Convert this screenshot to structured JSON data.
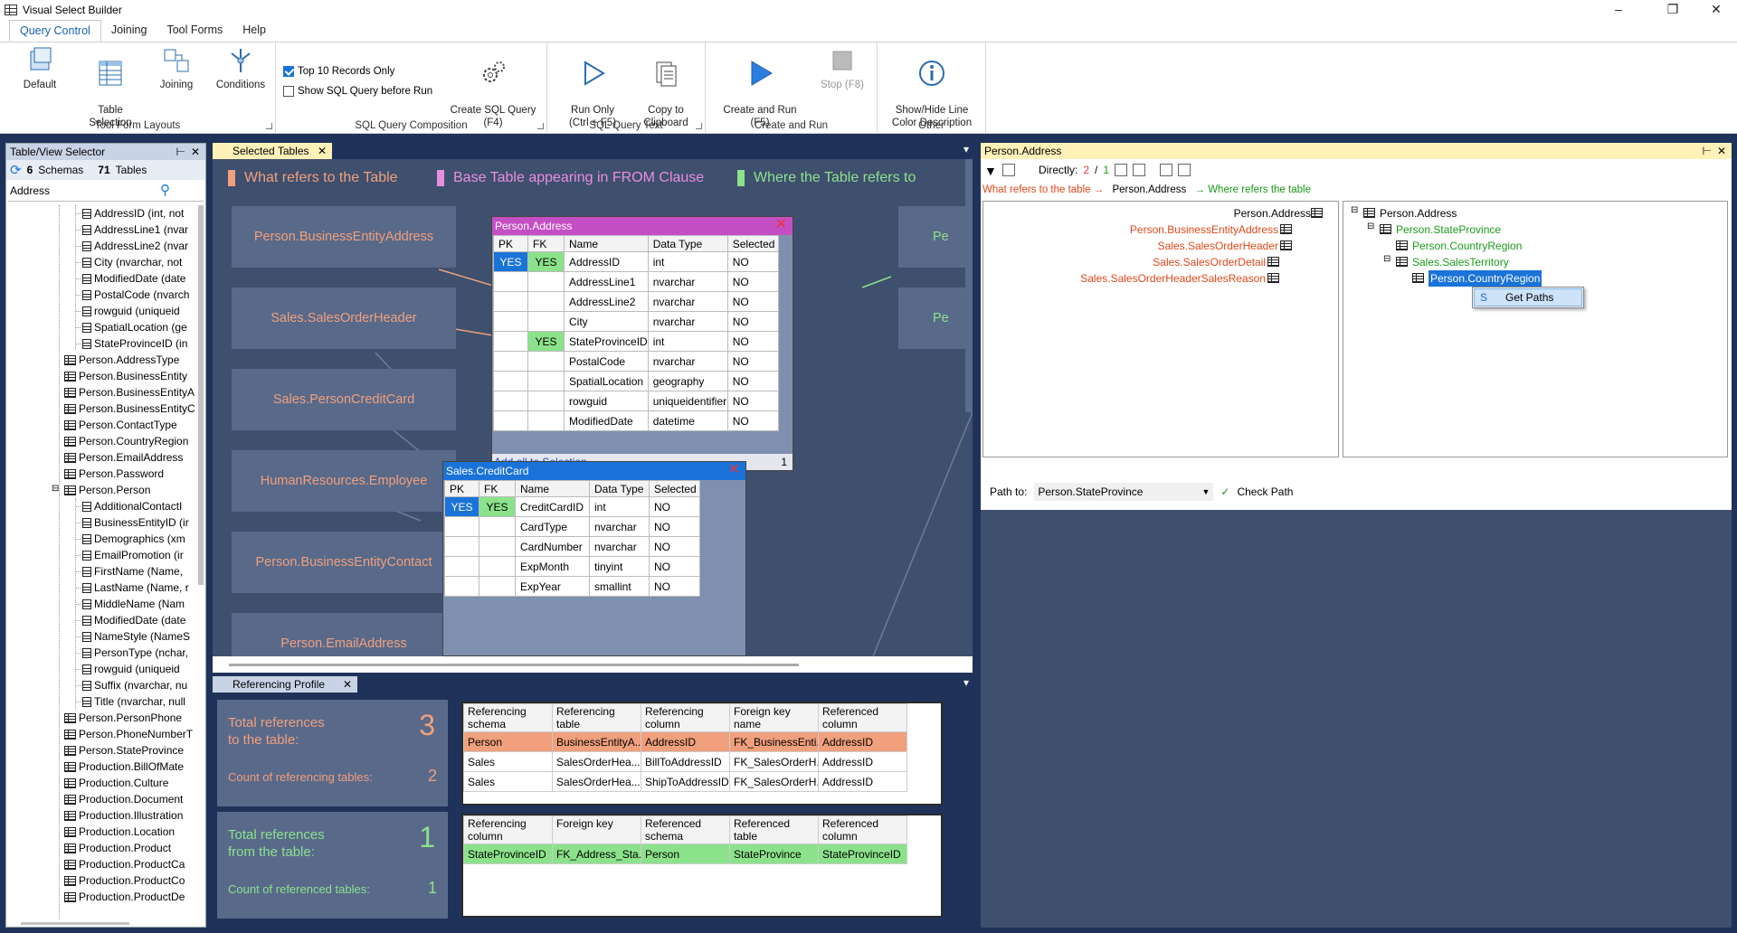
{
  "window": {
    "title": "Visual Select Builder"
  },
  "ribbon": {
    "tabs": [
      "Query Control",
      "Joining",
      "Tool Forms",
      "Help"
    ],
    "groups": {
      "layouts": {
        "label": "Tool Form Layouts",
        "default": "Default",
        "table_selection": "Table\nSelection",
        "joining": "Joining",
        "conditions": "Conditions"
      },
      "composition": {
        "label": "SQL Query Composition",
        "top10": "Top 10 Records Only",
        "top10_checked": true,
        "show_sql": "Show SQL Query before Run",
        "show_sql_checked": false,
        "create_sql": "Create SQL Query\n(F4)"
      },
      "text": {
        "label": "SQL Query Text",
        "run_only": "Run Only\n(Ctrl + F5)",
        "copy": "Copy to\nClipboard"
      },
      "run": {
        "label": "Create and Run",
        "create_run": "Create and Run\n(F5)",
        "stop": "Stop (F8)"
      },
      "other": {
        "label": "Other",
        "show_hide": "Show/Hide Line\nColor Description"
      }
    }
  },
  "left": {
    "title": "Table/View Selector",
    "schemas_count": "6",
    "schemas_label": "Schemas",
    "tables_count": "71",
    "tables_label": "Tables",
    "search_value": "Address",
    "tree": [
      {
        "type": "col",
        "label": "AddressID (int, not"
      },
      {
        "type": "col",
        "label": "AddressLine1 (nvar"
      },
      {
        "type": "col",
        "label": "AddressLine2 (nvar"
      },
      {
        "type": "col",
        "label": "City (nvarchar, not"
      },
      {
        "type": "col",
        "label": "ModifiedDate (date"
      },
      {
        "type": "col",
        "label": "PostalCode (nvarch"
      },
      {
        "type": "col",
        "label": "rowguid (uniqueid"
      },
      {
        "type": "col",
        "label": "SpatialLocation (ge"
      },
      {
        "type": "col",
        "label": "StateProvinceID (in"
      },
      {
        "type": "tbl",
        "label": "Person.AddressType"
      },
      {
        "type": "tbl",
        "label": "Person.BusinessEntity"
      },
      {
        "type": "tbl",
        "label": "Person.BusinessEntityA"
      },
      {
        "type": "tbl",
        "label": "Person.BusinessEntityC"
      },
      {
        "type": "tbl",
        "label": "Person.ContactType"
      },
      {
        "type": "tbl",
        "label": "Person.CountryRegion"
      },
      {
        "type": "tbl",
        "label": "Person.EmailAddress"
      },
      {
        "type": "tbl",
        "label": "Person.Password"
      },
      {
        "type": "tbl",
        "label": "Person.Person",
        "expanded": true
      },
      {
        "type": "col",
        "label": "AdditionalContactI"
      },
      {
        "type": "col",
        "label": "BusinessEntityID (ir"
      },
      {
        "type": "col",
        "label": "Demographics (xm"
      },
      {
        "type": "col",
        "label": "EmailPromotion (ir"
      },
      {
        "type": "col",
        "label": "FirstName (Name,"
      },
      {
        "type": "col",
        "label": "LastName (Name, r"
      },
      {
        "type": "col",
        "label": "MiddleName (Nam"
      },
      {
        "type": "col",
        "label": "ModifiedDate (date"
      },
      {
        "type": "col",
        "label": "NameStyle (NameS"
      },
      {
        "type": "col",
        "label": "PersonType (nchar,"
      },
      {
        "type": "col",
        "label": "rowguid (uniqueid"
      },
      {
        "type": "col",
        "label": "Suffix (nvarchar, nu"
      },
      {
        "type": "col",
        "label": "Title (nvarchar, null"
      },
      {
        "type": "tbl",
        "label": "Person.PersonPhone"
      },
      {
        "type": "tbl",
        "label": "Person.PhoneNumberT"
      },
      {
        "type": "tbl",
        "label": "Person.StateProvince"
      },
      {
        "type": "tbl",
        "label": "Production.BillOfMate"
      },
      {
        "type": "tbl",
        "label": "Production.Culture"
      },
      {
        "type": "tbl",
        "label": "Production.Document"
      },
      {
        "type": "tbl",
        "label": "Production.Illustration"
      },
      {
        "type": "tbl",
        "label": "Production.Location"
      },
      {
        "type": "tbl",
        "label": "Production.Product"
      },
      {
        "type": "tbl",
        "label": "Production.ProductCa"
      },
      {
        "type": "tbl",
        "label": "Production.ProductCo"
      },
      {
        "type": "tbl",
        "label": "Production.ProductDe"
      }
    ]
  },
  "center": {
    "tab": "Selected Tables",
    "legend": [
      {
        "label": "What refers to the Table",
        "color": "#f0a07c"
      },
      {
        "label": "Base Table appearing in FROM Clause",
        "color": "#e88ee0"
      },
      {
        "label": "Where the Table refers to",
        "color": "#8be28b"
      }
    ],
    "entities": [
      "Person.BusinessEntityAddress",
      "Sales.SalesOrderHeader",
      "Sales.PersonCreditCard",
      "HumanResources.Employee",
      "Person.BusinessEntityContact",
      "Person.EmailAddress"
    ],
    "right_entities": [
      "Pe",
      "Pe"
    ],
    "address_table": {
      "title": "Person.Address",
      "headers": [
        "PK",
        "FK",
        "Name",
        "Data Type",
        "Selected"
      ],
      "rows": [
        [
          "YES",
          "YES",
          "AddressID",
          "int",
          "NO"
        ],
        [
          "",
          "",
          "AddressLine1",
          "nvarchar",
          "NO"
        ],
        [
          "",
          "",
          "AddressLine2",
          "nvarchar",
          "NO"
        ],
        [
          "",
          "",
          "City",
          "nvarchar",
          "NO"
        ],
        [
          "",
          "YES",
          "StateProvinceID",
          "int",
          "NO"
        ],
        [
          "",
          "",
          "PostalCode",
          "nvarchar",
          "NO"
        ],
        [
          "",
          "",
          "SpatialLocation",
          "geography",
          "NO"
        ],
        [
          "",
          "",
          "rowguid",
          "uniqueidentifier",
          "NO"
        ],
        [
          "",
          "",
          "ModifiedDate",
          "datetime",
          "NO"
        ]
      ],
      "add_all": "Add all to Selection",
      "count": "1"
    },
    "credit_table": {
      "title": "Sales.CreditCard",
      "headers": [
        "PK",
        "FK",
        "Name",
        "Data Type",
        "Selected"
      ],
      "rows": [
        [
          "YES",
          "YES",
          "CreditCardID",
          "int",
          "NO"
        ],
        [
          "",
          "",
          "CardType",
          "nvarchar",
          "NO"
        ],
        [
          "",
          "",
          "CardNumber",
          "nvarchar",
          "NO"
        ],
        [
          "",
          "",
          "ExpMonth",
          "tinyint",
          "NO"
        ],
        [
          "",
          "",
          "ExpYear",
          "smallint",
          "NO"
        ]
      ]
    }
  },
  "profile": {
    "tab": "Referencing Profile",
    "to": {
      "title": "Total references\nto the table:",
      "total": "3",
      "count_label": "Count of referencing tables:",
      "count": "2",
      "headers": [
        "Referencing\nschema",
        "Referencing\ntable",
        "Referencing\ncolumn",
        "Foreign key\nname",
        "Referenced\ncolumn"
      ],
      "rows": [
        [
          "Person",
          "BusinessEntityA...",
          "AddressID",
          "FK_BusinessEnti...",
          "AddressID"
        ],
        [
          "Sales",
          "SalesOrderHea...",
          "BillToAddressID",
          "FK_SalesOrderH...",
          "AddressID"
        ],
        [
          "Sales",
          "SalesOrderHea...",
          "ShipToAddressID",
          "FK_SalesOrderH...",
          "AddressID"
        ]
      ]
    },
    "from": {
      "title": "Total references\nfrom the table:",
      "total": "1",
      "count_label": "Count of referenced tables:",
      "count": "1",
      "headers": [
        "Referencing\ncolumn",
        "Foreign key",
        "Referenced\nschema",
        "Referenced\ntable",
        "Referenced\ncolumn"
      ],
      "rows": [
        [
          "StateProvinceID",
          "FK_Address_Sta...",
          "Person",
          "StateProvince",
          "StateProvinceID"
        ]
      ]
    }
  },
  "right": {
    "title": "Person.Address",
    "directly_label": "Directly:",
    "directly_red": "2",
    "directly_sep": "/",
    "directly_green": "1",
    "path_what": "What refers to the table",
    "path_table": "Person.Address",
    "path_where": "Where refers the table",
    "left_tree": [
      "Person.Address",
      "Person.BusinessEntityAddress",
      "Sales.SalesOrderHeader",
      "Sales.SalesOrderDetail",
      "Sales.SalesOrderHeaderSalesReason"
    ],
    "right_tree": [
      "Person.Address",
      "Person.StateProvince",
      "Person.CountryRegion",
      "Sales.SalesTerritory",
      "Person.CountryRegion"
    ],
    "ctx_menu": "Get Paths",
    "path_to_label": "Path to:",
    "path_to_value": "Person.StateProvince",
    "check_path": "Check Path"
  }
}
